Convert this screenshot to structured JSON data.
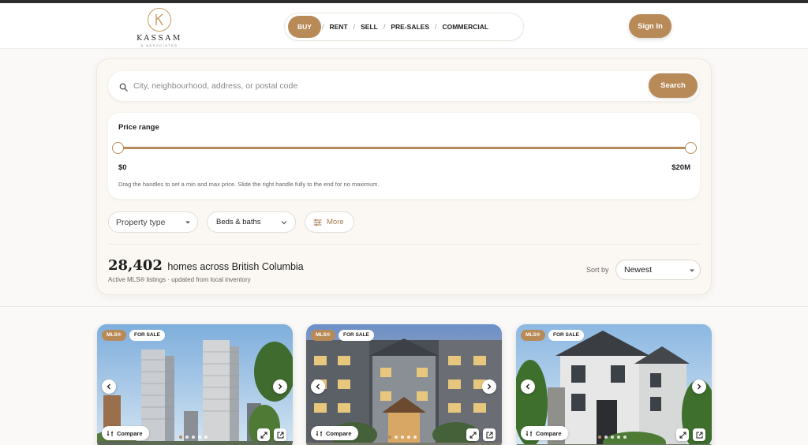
{
  "header": {
    "logo_name": "KASSAM",
    "logo_sub": "& ASSOCIATES",
    "nav": [
      {
        "label": "BUY",
        "active": true
      },
      {
        "label": "RENT",
        "active": false
      },
      {
        "label": "SELL",
        "active": false
      },
      {
        "label": "PRE-SALES",
        "active": false
      },
      {
        "label": "COMMERCIAL",
        "active": false
      }
    ],
    "nav_separator": "/",
    "signin_label": "Sign In"
  },
  "search": {
    "placeholder": "City, neighbourhood, address, or postal code",
    "value": "",
    "button_label": "Search",
    "icon": "search-icon"
  },
  "price_range": {
    "title": "Price range",
    "min_label": "$0",
    "max_label": "$20M",
    "min_value_fraction": 0,
    "max_value_fraction": 1,
    "hint": "Drag the handles to set a min and max price. Slide the right handle fully to the end for no maximum."
  },
  "filters": {
    "property_type": "Property type",
    "beds_baths": "Beds & baths",
    "more": "More"
  },
  "results": {
    "count": "28,402",
    "count_text": "homes across British Columbia",
    "subtitle": "Active MLS® listings · updated from local inventory",
    "sort_label": "Sort by",
    "sort_value": "Newest"
  },
  "listings": [
    {
      "mls_badge": "MLS®",
      "status_badge": "FOR SALE",
      "compare_label": "Compare",
      "photo_index": 1,
      "photo_count": 5
    },
    {
      "mls_badge": "MLS®",
      "status_badge": "FOR SALE",
      "compare_label": "Compare",
      "photo_index": 1,
      "photo_count": 5
    },
    {
      "mls_badge": "MLS®",
      "status_badge": "FOR SALE",
      "compare_label": "Compare",
      "photo_index": 1,
      "photo_count": 5
    }
  ],
  "colors": {
    "accent": "#b88a58",
    "background": "#faf9f7",
    "panel": "#fbf8f3"
  }
}
